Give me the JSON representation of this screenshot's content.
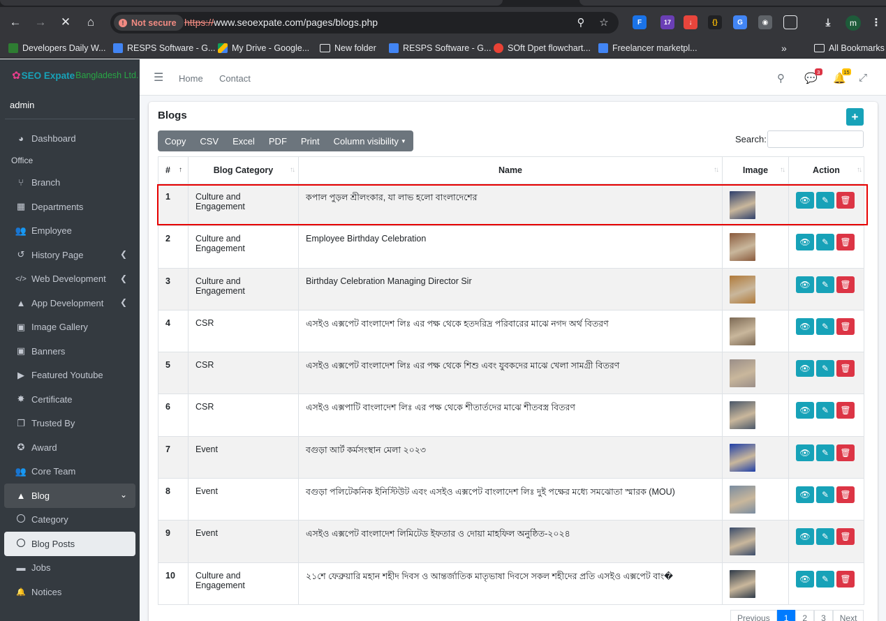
{
  "browser": {
    "security_label": "Not secure",
    "url_scheme": "https://",
    "url_rest": "www.seoexpate.com/pages/blogs.php",
    "profile_initial": "m",
    "extension_badge": "17",
    "bookmarks": [
      {
        "label": "Developers Daily W...",
        "color": "#2e7d32"
      },
      {
        "label": "RESPS Software - G...",
        "color": "#4285f4"
      },
      {
        "label": "My Drive - Google...",
        "color": "#fbbc04"
      },
      {
        "label": "New folder",
        "color": "folder"
      },
      {
        "label": "RESPS Software - G...",
        "color": "#4285f4"
      },
      {
        "label": "SOft Dpet flowchart...",
        "color": "#e94235"
      },
      {
        "label": "Freelancer marketpl...",
        "color": "#4285f4"
      }
    ],
    "all_bookmarks": "All Bookmarks"
  },
  "sidebar": {
    "brand_seo": "SEO Expate",
    "brand_rest": "Bangladesh Ltd.",
    "user": "admin",
    "office_header": "Office",
    "items": [
      {
        "label": "Dashboard",
        "icon": "gauge-icon",
        "glyph": "◕"
      },
      {
        "label": "Branch",
        "icon": "branch-icon",
        "glyph": "⑂"
      },
      {
        "label": "Departments",
        "icon": "building-icon",
        "glyph": "▦"
      },
      {
        "label": "Employee",
        "icon": "users-icon",
        "glyph": "👥"
      },
      {
        "label": "History Page",
        "icon": "history-icon",
        "glyph": "↺"
      },
      {
        "label": "Web Development",
        "icon": "code-icon",
        "glyph": "</>"
      },
      {
        "label": "App Development",
        "icon": "android-icon",
        "glyph": "▲"
      },
      {
        "label": "Image Gallery",
        "icon": "image-icon",
        "glyph": "▣"
      },
      {
        "label": "Banners",
        "icon": "banner-icon",
        "glyph": "▣"
      },
      {
        "label": "Featured Youtube",
        "icon": "youtube-icon",
        "glyph": "▶"
      },
      {
        "label": "Certificate",
        "icon": "certificate-icon",
        "glyph": "✸"
      },
      {
        "label": "Trusted By",
        "icon": "copy-icon",
        "glyph": "❐"
      },
      {
        "label": "Award",
        "icon": "award-icon",
        "glyph": "✪"
      },
      {
        "label": "Core Team",
        "icon": "team-icon",
        "glyph": "👥"
      },
      {
        "label": "Blog",
        "icon": "android-icon",
        "glyph": "▲"
      },
      {
        "label": "Category",
        "icon": "circle-icon"
      },
      {
        "label": "Blog Posts",
        "icon": "circle-icon"
      },
      {
        "label": "Jobs",
        "icon": "briefcase-icon",
        "glyph": "▬"
      },
      {
        "label": "Notices",
        "icon": "bell-icon",
        "glyph": "🔔"
      }
    ]
  },
  "topnav": {
    "home": "Home",
    "contact": "Contact",
    "messages_badge": "3",
    "notifications_badge": "15"
  },
  "card": {
    "title": "Blogs",
    "add_label": "+",
    "buttons": [
      "Copy",
      "CSV",
      "Excel",
      "PDF",
      "Print",
      "Column visibility"
    ],
    "search_label": "Search:"
  },
  "table": {
    "headers": [
      "#",
      "Blog Category",
      "Name",
      "Image",
      "Action"
    ],
    "rows": [
      {
        "num": "1",
        "category": "Culture and Engagement",
        "name": "কপাল পুড়ল শ্রীলংকার, যা লাভ হলো বাংলাদেশের",
        "thumb": "#2e3f6b"
      },
      {
        "num": "2",
        "category": "Culture and Engagement",
        "name": "Employee Birthday Celebration",
        "thumb": "#8a5a3c"
      },
      {
        "num": "3",
        "category": "Culture and Engagement",
        "name": "Birthday Celebration Managing Director Sir",
        "thumb": "#b07a3a"
      },
      {
        "num": "4",
        "category": "CSR",
        "name": "এসইও এক্সপেট বাংলাদেশ লিঃ এর পক্ষ থেকে হতদরিদ্র পরিবারের মাঝে নগদ অর্থ বিতরণ",
        "thumb": "#7d6a55"
      },
      {
        "num": "5",
        "category": "CSR",
        "name": "এসইও এক্সপেট বাংলাদেশ লিঃ এর পক্ষ থেকে শিশু এবং যুবকদের মাঝে খেলা সামগ্রী বিতরণ",
        "thumb": "#9a8e88"
      },
      {
        "num": "6",
        "category": "CSR",
        "name": "এসইও এক্সপাটি বাংলাদেশ লিঃ এর পক্ষ থেকে শীতার্তদের মাঝে শীতবস্ত্র বিতরণ",
        "thumb": "#4a5768"
      },
      {
        "num": "7",
        "category": "Event",
        "name": "বগুড়া আর্ট কর্মসংস্থান মেলা ২০২৩",
        "thumb": "#1f3fa8"
      },
      {
        "num": "8",
        "category": "Event",
        "name": "বগুড়া পলিটেকনিক ইনিস্টিউট এবং এসইও এক্সপেট বাংলাদেশ লিঃ দুই পক্ষের মধ্যে সমঝোতা স্মারক (MOU)",
        "thumb": "#7a8ca0"
      },
      {
        "num": "9",
        "category": "Event",
        "name": "এসইও এক্সপেট বাংলাদেশ লিমিটেড ইফতার ও দোয়া মাহফিল অনুষ্ঠিত-২০২৪",
        "thumb": "#3b4c6a"
      },
      {
        "num": "10",
        "category": "Culture and Engagement",
        "name": "২১শে ফেব্রুয়ারি মহান শহীদ দিবস ও আন্তর্জাতিক মাতৃভাষা দিবসে সকল শহীদের প্রতি এসইও এক্সপেট বাং�",
        "thumb": "#2f3a48"
      }
    ]
  },
  "pagination": [
    "Previous",
    "1",
    "2",
    "3",
    "Next"
  ]
}
